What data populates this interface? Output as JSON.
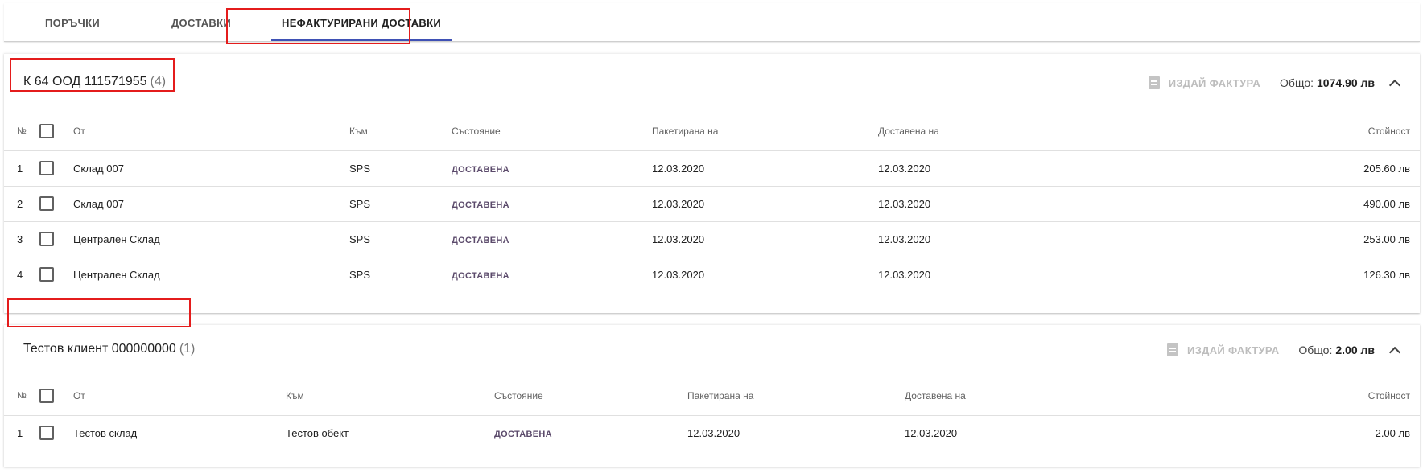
{
  "tabs": [
    {
      "label": "ПОРЪЧКИ"
    },
    {
      "label": "ДОСТАВКИ"
    },
    {
      "label": "НЕФАКТУРИРАНИ ДОСТАВКИ"
    }
  ],
  "colors": {
    "accent": "#3f51b5",
    "annotation": "#e41c1c",
    "status": "#5b4a6b"
  },
  "groups": [
    {
      "client": "К 64 ООД 111571955",
      "count": "(4)",
      "invoice_label": "ИЗДАЙ ФАКТУРА",
      "total_label": "Общо:",
      "total_value": "1074.90 лв",
      "columns": {
        "num": "№",
        "from": "От",
        "to": "Към",
        "status": "Състояние",
        "packed": "Пакетирана на",
        "delivered": "Доставена на",
        "value": "Стойност"
      },
      "rows": [
        {
          "num": "1",
          "from": "Склад 007",
          "to": "SPS",
          "status": "ДОСТАВЕНА",
          "packed": "12.03.2020",
          "delivered": "12.03.2020",
          "value": "205.60 лв"
        },
        {
          "num": "2",
          "from": "Склад 007",
          "to": "SPS",
          "status": "ДОСТАВЕНА",
          "packed": "12.03.2020",
          "delivered": "12.03.2020",
          "value": "490.00 лв"
        },
        {
          "num": "3",
          "from": "Централен Склад",
          "to": "SPS",
          "status": "ДОСТАВЕНА",
          "packed": "12.03.2020",
          "delivered": "12.03.2020",
          "value": "253.00 лв"
        },
        {
          "num": "4",
          "from": "Централен Склад",
          "to": "SPS",
          "status": "ДОСТАВЕНА",
          "packed": "12.03.2020",
          "delivered": "12.03.2020",
          "value": "126.30 лв"
        }
      ]
    },
    {
      "client": "Тестов клиент 000000000",
      "count": "(1)",
      "invoice_label": "ИЗДАЙ ФАКТУРА",
      "total_label": "Общо:",
      "total_value": "2.00 лв",
      "columns": {
        "num": "№",
        "from": "От",
        "to": "Към",
        "status": "Състояние",
        "packed": "Пакетирана на",
        "delivered": "Доставена на",
        "value": "Стойност"
      },
      "rows": [
        {
          "num": "1",
          "from": "Тестов склад",
          "to": "Тестов обект",
          "status": "ДОСТАВЕНА",
          "packed": "12.03.2020",
          "delivered": "12.03.2020",
          "value": "2.00 лв"
        }
      ]
    }
  ]
}
